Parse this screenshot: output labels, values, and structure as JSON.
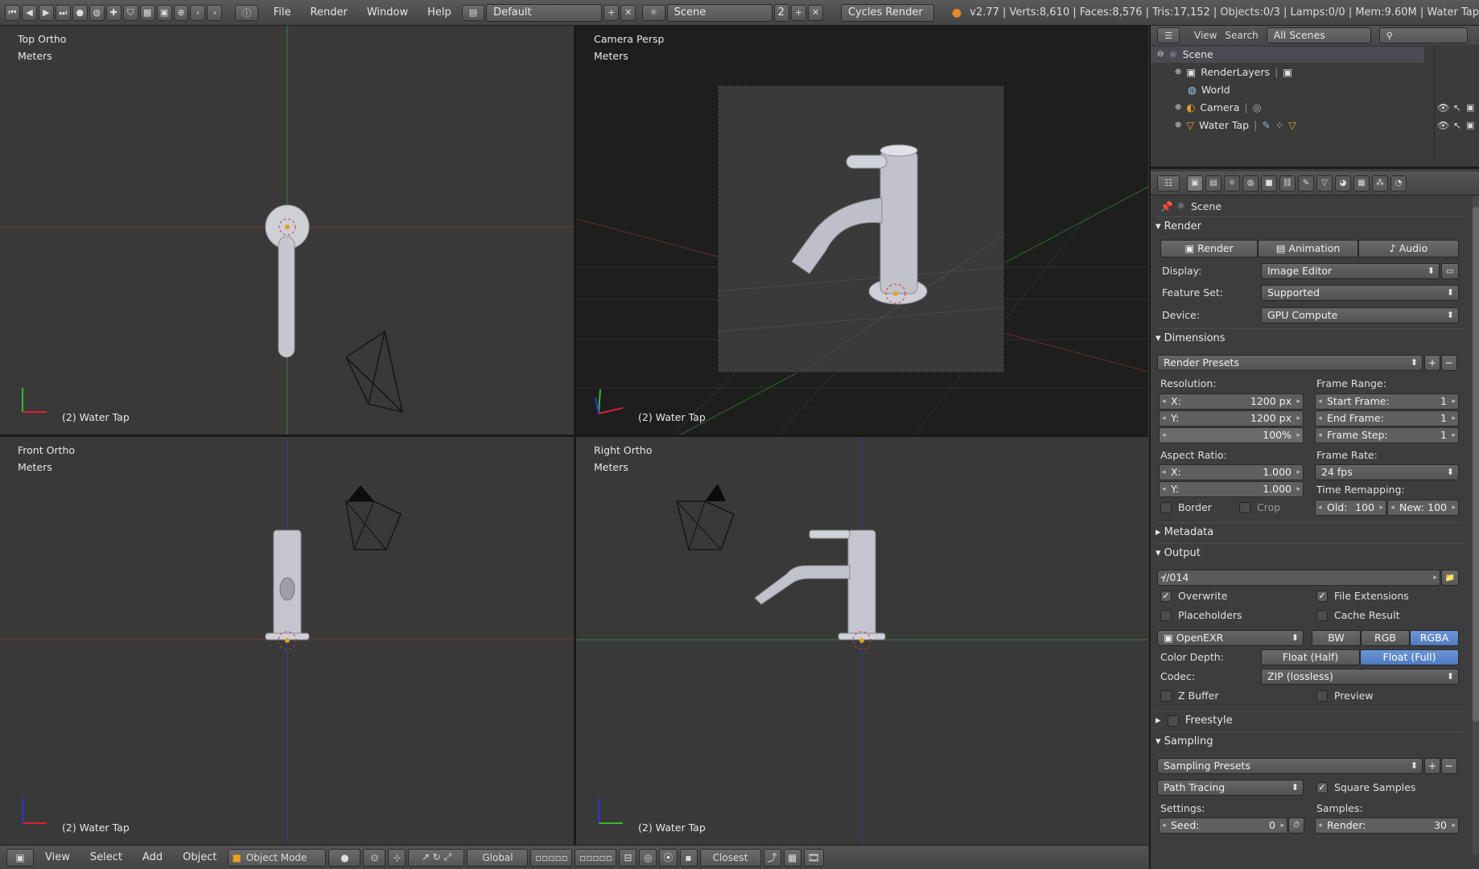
{
  "topbar": {
    "menus": [
      "File",
      "Render",
      "Window",
      "Help"
    ],
    "layout": "Default",
    "scene": "Scene",
    "scene_users": "2",
    "engine": "Cycles Render",
    "info": "v2.77 | Verts:8,610 | Faces:8,576 | Tris:17,152 | Objects:0/3 | Lamps:0/0 | Mem:9.60M | Water Tap"
  },
  "viewports": {
    "top": {
      "name": "Top Ortho",
      "units": "Meters",
      "object": "(2) Water Tap"
    },
    "camera": {
      "name": "Camera Persp",
      "units": "Meters",
      "object": "(2) Water Tap"
    },
    "front": {
      "name": "Front Ortho",
      "units": "Meters",
      "object": "(2) Water Tap"
    },
    "right": {
      "name": "Right Ortho",
      "units": "Meters",
      "object": "(2) Water Tap"
    }
  },
  "bottombar": {
    "menus": [
      "View",
      "Select",
      "Add",
      "Object"
    ],
    "mode": "Object Mode",
    "orientation": "Global",
    "snap": "Closest"
  },
  "outliner": {
    "menus": [
      "View",
      "Search"
    ],
    "filter": "All Scenes",
    "items": [
      "Scene",
      "RenderLayers",
      "World",
      "Camera",
      "Water Tap"
    ]
  },
  "properties": {
    "context": "Scene",
    "render": {
      "title": "Render",
      "buttons": [
        "Render",
        "Animation",
        "Audio"
      ],
      "display_label": "Display:",
      "display": "Image Editor",
      "feature_label": "Feature Set:",
      "feature": "Supported",
      "device_label": "Device:",
      "device": "GPU Compute"
    },
    "dimensions": {
      "title": "Dimensions",
      "presets": "Render Presets",
      "resolution_label": "Resolution:",
      "res_x_key": "X:",
      "res_x": "1200 px",
      "res_y_key": "Y:",
      "res_y": "1200 px",
      "res_pct": "100%",
      "frame_range_label": "Frame Range:",
      "start_key": "Start Frame:",
      "start": "1",
      "end_key": "End Frame:",
      "end": "1",
      "step_key": "Frame Step:",
      "step": "1",
      "aspect_label": "Aspect Ratio:",
      "asp_x_key": "X:",
      "asp_x": "1.000",
      "asp_y_key": "Y:",
      "asp_y": "1.000",
      "frame_rate_label": "Frame Rate:",
      "frame_rate": "24 fps",
      "remap_label": "Time Remapping:",
      "old_key": "Old:",
      "old": "100",
      "new_key": "New:",
      "new": "100",
      "border": "Border",
      "crop": "Crop"
    },
    "metadata": {
      "title": "Metadata"
    },
    "output": {
      "title": "Output",
      "path": "//014",
      "overwrite": "Overwrite",
      "file_ext": "File Extensions",
      "placeholders": "Placeholders",
      "cache": "Cache Result",
      "format": "OpenEXR",
      "color_modes": [
        "BW",
        "RGB",
        "RGBA"
      ],
      "depth_label": "Color Depth:",
      "depth_half": "Float (Half)",
      "depth_full": "Float (Full)",
      "codec_label": "Codec:",
      "codec": "ZIP (lossless)",
      "zbuffer": "Z Buffer",
      "preview": "Preview"
    },
    "freestyle": {
      "title": "Freestyle"
    },
    "sampling": {
      "title": "Sampling",
      "presets": "Sampling Presets",
      "integrator": "Path Tracing",
      "square": "Square Samples",
      "settings_label": "Settings:",
      "samples_label": "Samples:",
      "seed_key": "Seed:",
      "seed": "0",
      "render_key": "Render:",
      "render": "30"
    }
  }
}
